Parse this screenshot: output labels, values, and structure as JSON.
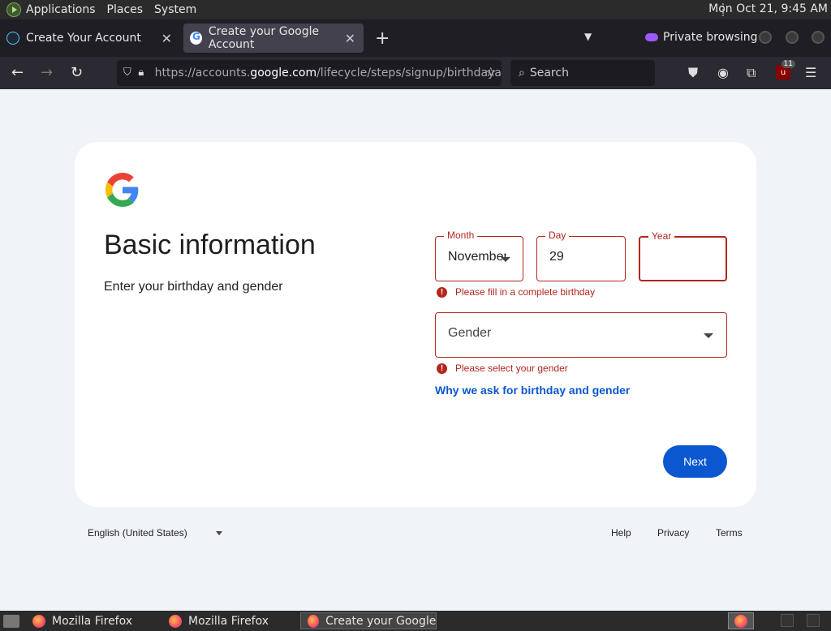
{
  "system_panel": {
    "menus": [
      "Applications",
      "Places",
      "System"
    ],
    "clock": "Mon Oct 21,  9:45 AM"
  },
  "browser": {
    "tabs": [
      {
        "title": "Create Your Account",
        "active": false
      },
      {
        "title": "Create your Google Account",
        "active": true
      }
    ],
    "private_label": "Private browsing",
    "url_prefix": "https://accounts.",
    "url_domain": "google.com",
    "url_suffix": "/lifecycle/steps/signup/birthdaya",
    "search_placeholder": "Search",
    "ublock_count": "11"
  },
  "page": {
    "title": "Basic information",
    "subtitle": "Enter your birthday and gender",
    "month": {
      "label": "Month",
      "value": "November"
    },
    "day": {
      "label": "Day",
      "value": "29"
    },
    "year": {
      "label": "Year",
      "value": ""
    },
    "birthday_error": "Please fill in a complete birthday",
    "gender": {
      "placeholder": "Gender"
    },
    "gender_error": "Please select your gender",
    "why_link": "Why we ask for birthday and gender",
    "next_button": "Next",
    "error_color": "#b3261e",
    "accent_color": "#0b57d0"
  },
  "footer": {
    "language": "English (United States)",
    "links": [
      "Help",
      "Privacy",
      "Terms"
    ]
  },
  "taskbar": {
    "items": [
      "Mozilla Firefox",
      "Mozilla Firefox",
      "Create your Google ..."
    ]
  }
}
